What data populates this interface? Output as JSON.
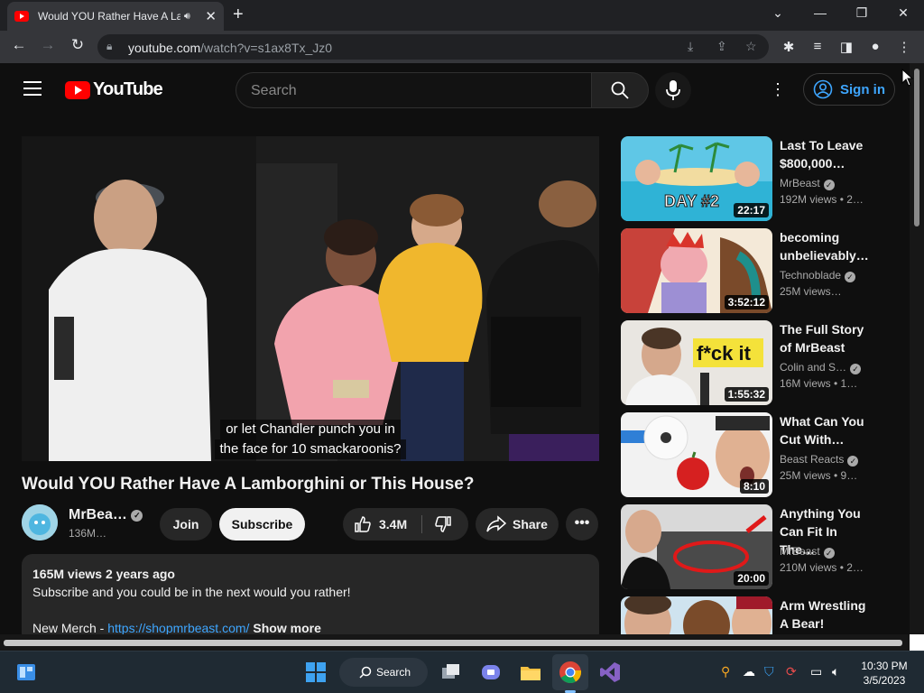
{
  "browser": {
    "tab_title": "Would YOU Rather Have A La",
    "audio_icon": "speaker-icon",
    "url_host": "youtube.com",
    "url_path": "/watch?v=s1ax8Tx_Jz0"
  },
  "header": {
    "logo_text": "YouTube",
    "search_placeholder": "Search",
    "signin_label": "Sign in"
  },
  "video": {
    "caption_line1": "or let Chandler punch you in",
    "caption_line2": "the face for 10 smackaroonis?",
    "title": "Would YOU Rather Have A Lamborghini or This House?",
    "channel": "MrBea…",
    "subscribers": "136M…",
    "join_label": "Join",
    "subscribe_label": "Subscribe",
    "likes": "3.4M",
    "share_label": "Share",
    "more_label": "•••"
  },
  "description": {
    "stats": "165M views  2 years ago",
    "line1": "Subscribe and you could be in the next would you rather!",
    "merch_prefix": "New Merch - ",
    "merch_link": "https://shopmrbeast.com/",
    "show_more": "Show more"
  },
  "recommendations": [
    {
      "title": "Last To Leave $800,000…",
      "channel": "MrBeast",
      "verified": true,
      "meta": "192M views  • 2…",
      "duration": "22:17"
    },
    {
      "title": "becoming unbelievably…",
      "channel": "Technoblade",
      "verified": true,
      "meta": "25M views…",
      "duration": "3:52:12"
    },
    {
      "title": "The Full Story of MrBeast",
      "channel": "Colin and S…",
      "verified": true,
      "meta": "16M views  • 1…",
      "duration": "1:55:32"
    },
    {
      "title": "What Can You Cut With…",
      "channel": "Beast Reacts",
      "verified": true,
      "meta": "25M views  • 9…",
      "duration": "8:10"
    },
    {
      "title": "Anything You Can Fit In The…",
      "channel": "MrBeast",
      "verified": true,
      "meta": "210M views  • 2…",
      "duration": "20:00"
    },
    {
      "title": "Arm Wrestling A Bear!",
      "channel": "",
      "verified": false,
      "meta": "",
      "duration": ""
    }
  ],
  "thumb_text": {
    "day2": "DAY #2",
    "fck": "f*ck it"
  },
  "taskbar": {
    "search_label": "Search",
    "time": "10:30 PM",
    "date": "3/5/2023"
  },
  "colors": {
    "background": "#0f0f0f",
    "accent_blue": "#3ea6ff",
    "youtube_red": "#ff0000"
  }
}
